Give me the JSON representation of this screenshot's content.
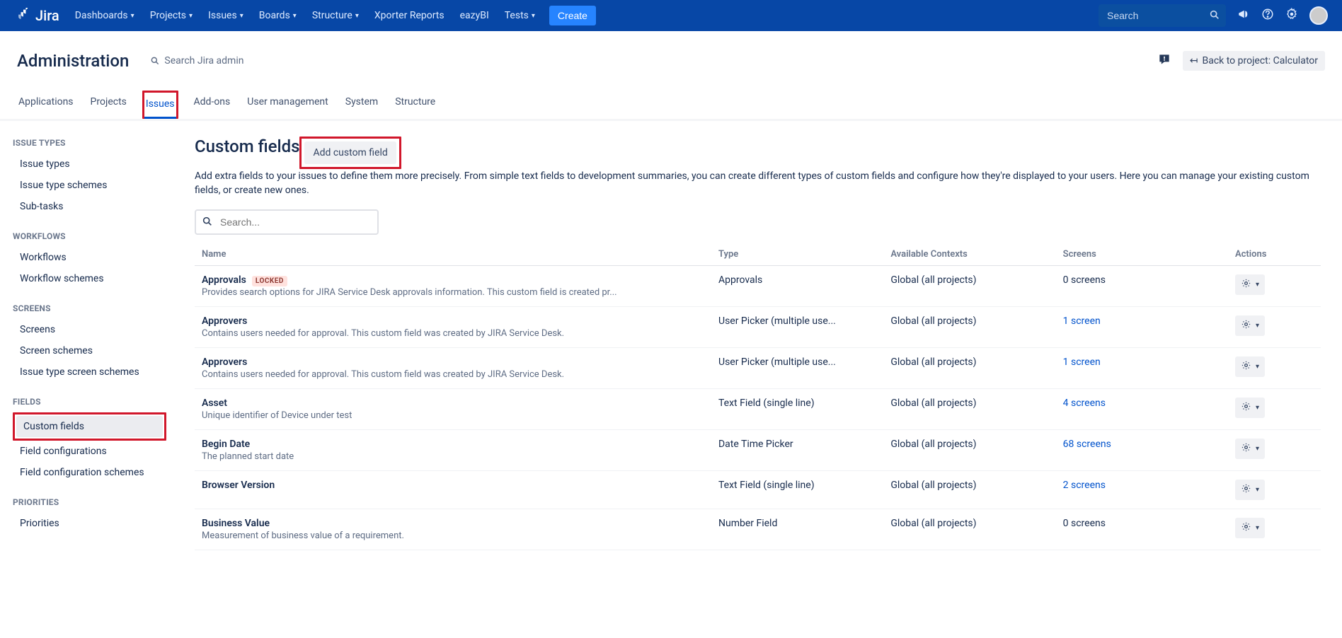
{
  "topnav": {
    "items": [
      "Dashboards",
      "Projects",
      "Issues",
      "Boards",
      "Structure",
      "Xporter Reports",
      "eazyBI",
      "Tests"
    ],
    "dropdown": [
      true,
      true,
      true,
      true,
      true,
      false,
      false,
      true
    ],
    "create": "Create",
    "search_placeholder": "Search"
  },
  "admin": {
    "title": "Administration",
    "search_label": "Search Jira admin",
    "back_label": "Back to project: Calculator",
    "tabs": [
      "Applications",
      "Projects",
      "Issues",
      "Add-ons",
      "User management",
      "System",
      "Structure"
    ],
    "active_tab_index": 2,
    "highlight_tab_index": 2
  },
  "sidebar": {
    "sections": [
      {
        "title": "ISSUE TYPES",
        "items": [
          "Issue types",
          "Issue type schemes",
          "Sub-tasks"
        ]
      },
      {
        "title": "WORKFLOWS",
        "items": [
          "Workflows",
          "Workflow schemes"
        ]
      },
      {
        "title": "SCREENS",
        "items": [
          "Screens",
          "Screen schemes",
          "Issue type screen schemes"
        ]
      },
      {
        "title": "FIELDS",
        "items": [
          "Custom fields",
          "Field configurations",
          "Field configuration schemes"
        ]
      },
      {
        "title": "PRIORITIES",
        "items": [
          "Priorities"
        ]
      }
    ],
    "selected": "Custom fields"
  },
  "page": {
    "title": "Custom fields",
    "add_button": "Add custom field",
    "description": "Add extra fields to your issues to define them more precisely. From simple text fields to development summaries, you can create different types of custom fields and configure how they're displayed to your users. Here you can manage your existing custom fields, or create new ones.",
    "search_placeholder": "Search..."
  },
  "table": {
    "columns": [
      "Name",
      "Type",
      "Available Contexts",
      "Screens",
      "Actions"
    ],
    "rows": [
      {
        "name": "Approvals",
        "locked": true,
        "sub": "Provides search options for JIRA Service Desk approvals information. This custom field is created pr...",
        "type": "Approvals",
        "ctx": "Global (all projects)",
        "screens": "0 screens",
        "screens_link": false
      },
      {
        "name": "Approvers",
        "locked": false,
        "sub": "Contains users needed for approval. This custom field was created by JIRA Service Desk.",
        "type": "User Picker (multiple use...",
        "ctx": "Global (all projects)",
        "screens": "1 screen",
        "screens_link": true
      },
      {
        "name": "Approvers",
        "locked": false,
        "sub": "Contains users needed for approval. This custom field was created by JIRA Service Desk.",
        "type": "User Picker (multiple use...",
        "ctx": "Global (all projects)",
        "screens": "1 screen",
        "screens_link": true
      },
      {
        "name": "Asset",
        "locked": false,
        "sub": "Unique identifier of Device under test",
        "type": "Text Field (single line)",
        "ctx": "Global (all projects)",
        "screens": "4 screens",
        "screens_link": true
      },
      {
        "name": "Begin Date",
        "locked": false,
        "sub": "The planned start date",
        "type": "Date Time Picker",
        "ctx": "Global (all projects)",
        "screens": "68 screens",
        "screens_link": true
      },
      {
        "name": "Browser Version",
        "locked": false,
        "sub": "",
        "type": "Text Field (single line)",
        "ctx": "Global (all projects)",
        "screens": "2 screens",
        "screens_link": true
      },
      {
        "name": "Business Value",
        "locked": false,
        "sub": "Measurement of business value of a requirement.",
        "type": "Number Field",
        "ctx": "Global (all projects)",
        "screens": "0 screens",
        "screens_link": false
      }
    ]
  }
}
